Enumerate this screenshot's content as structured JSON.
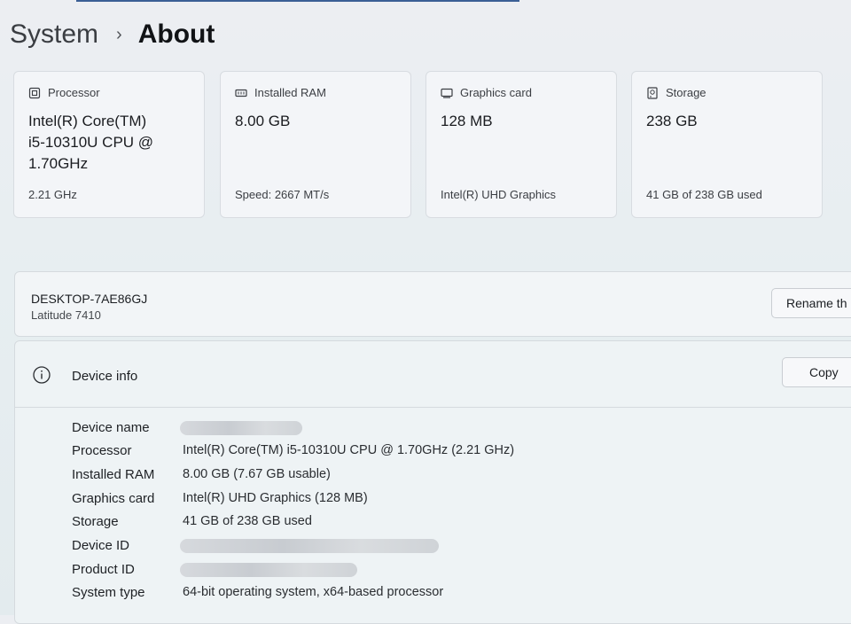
{
  "breadcrumb": {
    "parent": "System",
    "separator": "›",
    "current": "About"
  },
  "cards": [
    {
      "label": "Processor",
      "value": "Intel(R) Core(TM) i5-10310U CPU @ 1.70GHz",
      "sub": "2.21 GHz",
      "icon": "processor-icon"
    },
    {
      "label": "Installed RAM",
      "value": "8.00 GB",
      "sub": "Speed: 2667 MT/s",
      "icon": "ram-icon"
    },
    {
      "label": "Graphics card",
      "value": "128 MB",
      "sub": "Intel(R) UHD Graphics",
      "icon": "graphics-card-icon"
    },
    {
      "label": "Storage",
      "value": "238 GB",
      "sub": "41 GB of 238 GB used",
      "icon": "storage-icon"
    }
  ],
  "device": {
    "name": "DESKTOP-7AE86GJ",
    "model": "Latitude 7410",
    "rename_label": "Rename th"
  },
  "device_info": {
    "title": "Device info",
    "copy_label": "Copy",
    "rows": [
      {
        "label": "Device name",
        "value": "",
        "redacted": true
      },
      {
        "label": "Processor",
        "value": "Intel(R) Core(TM) i5-10310U CPU @ 1.70GHz (2.21 GHz)"
      },
      {
        "label": "Installed RAM",
        "value": "8.00 GB (7.67 GB usable)"
      },
      {
        "label": "Graphics card",
        "value": "Intel(R) UHD Graphics (128 MB)"
      },
      {
        "label": "Storage",
        "value": "41 GB of 238 GB used"
      },
      {
        "label": "Device ID",
        "value": "",
        "redacted": true
      },
      {
        "label": "Product ID",
        "value": "",
        "redacted": true
      },
      {
        "label": "System type",
        "value": "64-bit operating system, x64-based processor"
      }
    ]
  }
}
